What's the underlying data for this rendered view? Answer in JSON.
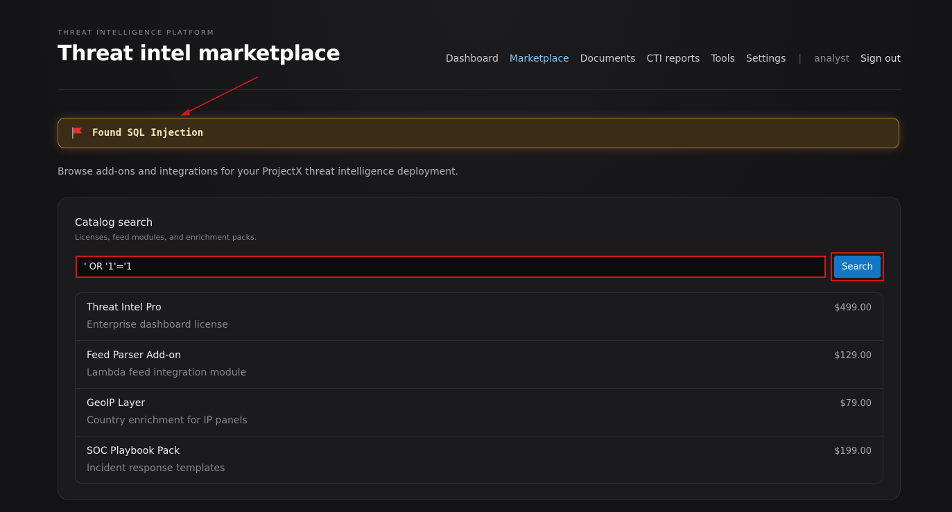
{
  "header": {
    "platform_label": "THREAT INTELLIGENCE PLATFORM",
    "title": "Threat intel marketplace"
  },
  "nav": {
    "items": [
      {
        "label": "Dashboard",
        "active": false
      },
      {
        "label": "Marketplace",
        "active": true
      },
      {
        "label": "Documents",
        "active": false
      },
      {
        "label": "CTI reports",
        "active": false
      },
      {
        "label": "Tools",
        "active": false
      },
      {
        "label": "Settings",
        "active": false
      }
    ],
    "separator": "|",
    "user": "analyst",
    "sign_out": "Sign out"
  },
  "flag_banner": {
    "icon": "red-flag-icon",
    "text": "Found SQL Injection"
  },
  "intro": "Browse add-ons and integrations for your ProjectX threat intelligence deployment.",
  "catalog": {
    "title": "Catalog search",
    "subtitle": "Licenses, feed modules, and enrichment packs.",
    "search_value": "' OR '1'='1",
    "search_button": "Search",
    "items": [
      {
        "name": "Threat Intel Pro",
        "description": "Enterprise dashboard license",
        "price": "$499.00"
      },
      {
        "name": "Feed Parser Add-on",
        "description": "Lambda feed integration module",
        "price": "$129.00"
      },
      {
        "name": "GeoIP Layer",
        "description": "Country enrichment for IP panels",
        "price": "$79.00"
      },
      {
        "name": "SOC Playbook Pack",
        "description": "Incident response templates",
        "price": "$199.00"
      }
    ]
  },
  "colors": {
    "accent": "#7cc3f5",
    "button": "#1377c7",
    "highlight": "#d01818",
    "flag_border": "#a67d32"
  }
}
